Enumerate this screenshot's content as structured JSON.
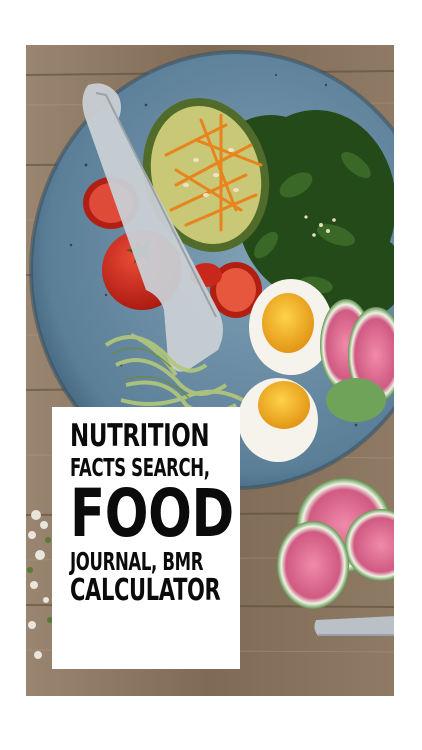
{
  "image": {
    "subject": "food-photo",
    "colors": {
      "wood": "#8a7560",
      "plate": "#6b8fa8",
      "plate_rim": "#3f6078",
      "tomato": "#c8281c",
      "carrot": "#e8841e",
      "greens": "#244a1a",
      "yolk": "#f2b21a",
      "radish_skin": "#6fa35a",
      "radish_flesh": "#d7628a"
    }
  },
  "caption": {
    "line1": "NUTRITION",
    "line2": "FACTS SEARCH,",
    "line3": "FOOD",
    "line4": "JOURNAL, BMR",
    "line5": "CALCULATOR"
  }
}
